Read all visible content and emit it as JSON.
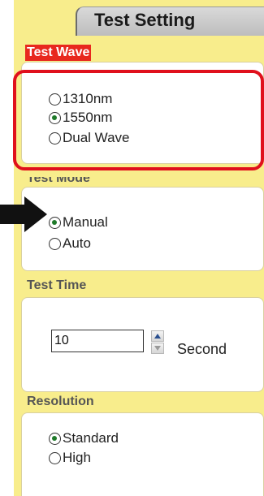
{
  "panel": {
    "title": "Test Setting"
  },
  "test_wave": {
    "label": "Test Wave",
    "options": [
      {
        "label": "1310nm",
        "checked": false
      },
      {
        "label": "1550nm",
        "checked": true
      },
      {
        "label": "Dual Wave",
        "checked": false
      }
    ]
  },
  "test_mode": {
    "label": "Test Mode",
    "options": [
      {
        "label": "Manual",
        "checked": true
      },
      {
        "label": "Auto",
        "checked": false
      }
    ]
  },
  "test_time": {
    "label": "Test Time",
    "value": "10",
    "unit": "Second"
  },
  "resolution": {
    "label": "Resolution",
    "options": [
      {
        "label": "Standard",
        "checked": true
      },
      {
        "label": "High",
        "checked": false
      }
    ]
  },
  "colors": {
    "panel_bg": "#f8ed8c",
    "highlight": "#e0101c",
    "label_red_bg": "#e8281e",
    "radio_dot": "#1f7a2a"
  }
}
